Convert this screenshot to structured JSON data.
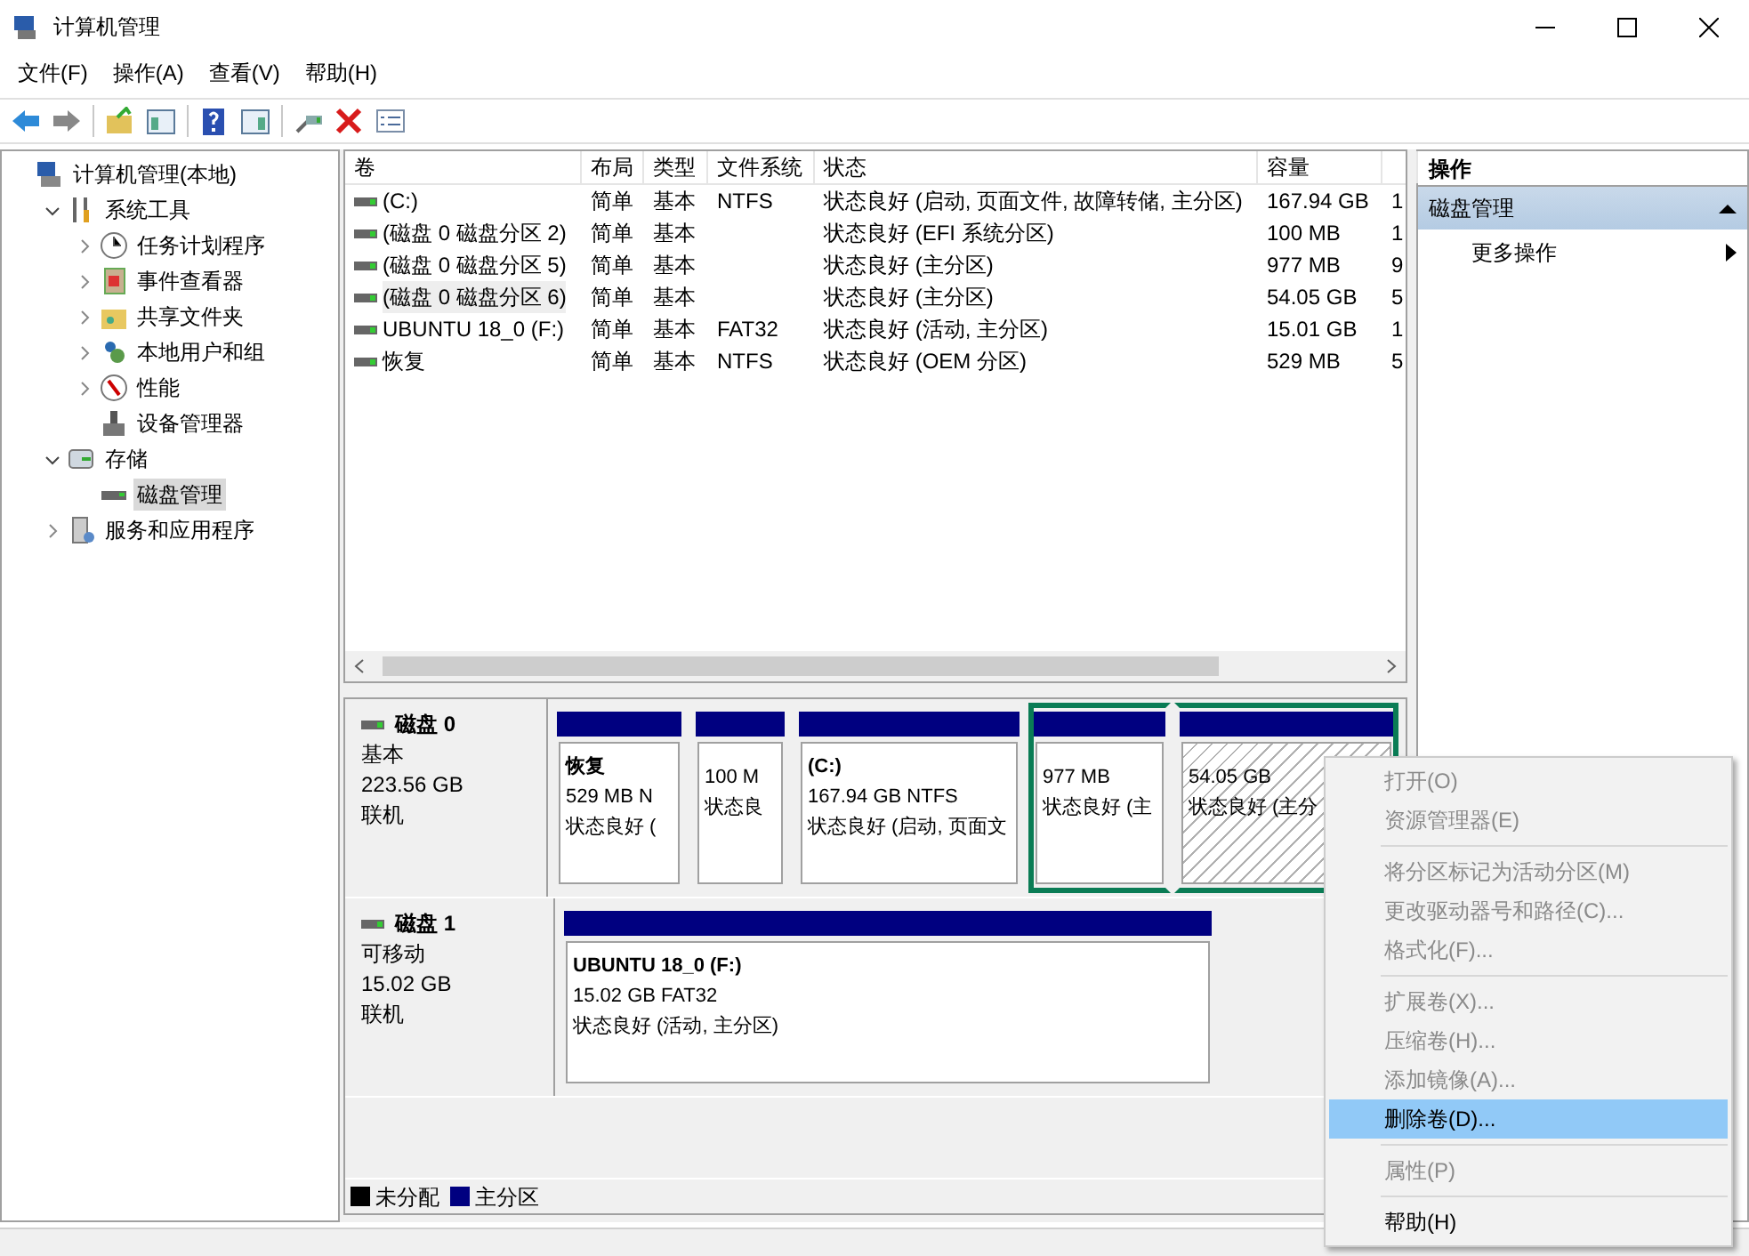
{
  "window": {
    "title": "计算机管理"
  },
  "menu": [
    "文件(F)",
    "操作(A)",
    "查看(V)",
    "帮助(H)"
  ],
  "tree": [
    {
      "label": "计算机管理(本地)",
      "selected": false,
      "children": [
        {
          "label": "系统工具",
          "selected": false,
          "expanded": true,
          "children": [
            {
              "label": "任务计划程序",
              "selected": false,
              "expanded": false
            },
            {
              "label": "事件查看器",
              "selected": false,
              "expanded": false
            },
            {
              "label": "共享文件夹",
              "selected": false,
              "expanded": false
            },
            {
              "label": "本地用户和组",
              "selected": false,
              "expanded": false
            },
            {
              "label": "性能",
              "selected": false,
              "expanded": false
            },
            {
              "label": "设备管理器",
              "selected": false
            }
          ]
        },
        {
          "label": "存储",
          "selected": false,
          "expanded": true,
          "children": [
            {
              "label": "磁盘管理",
              "selected": true
            }
          ]
        },
        {
          "label": "服务和应用程序",
          "selected": false,
          "expanded": false
        }
      ]
    }
  ],
  "table": {
    "columns": [
      "卷",
      "布局",
      "类型",
      "文件系统",
      "状态",
      "容量",
      ""
    ],
    "rows": [
      {
        "selected": false,
        "cells": [
          "(C:)",
          "简单",
          "基本",
          "NTFS",
          "状态良好 (启动, 页面文件, 故障转储, 主分区)",
          "167.94 GB",
          "1"
        ]
      },
      {
        "selected": false,
        "cells": [
          "(磁盘 0 磁盘分区 2)",
          "简单",
          "基本",
          "",
          "状态良好 (EFI 系统分区)",
          "100 MB",
          "1"
        ]
      },
      {
        "selected": false,
        "cells": [
          "(磁盘 0 磁盘分区 5)",
          "简单",
          "基本",
          "",
          "状态良好 (主分区)",
          "977 MB",
          "9"
        ]
      },
      {
        "selected": true,
        "cells": [
          "(磁盘 0 磁盘分区 6)",
          "简单",
          "基本",
          "",
          "状态良好 (主分区)",
          "54.05 GB",
          "5"
        ]
      },
      {
        "selected": false,
        "cells": [
          "UBUNTU 18_0 (F:)",
          "简单",
          "基本",
          "FAT32",
          "状态良好 (活动, 主分区)",
          "15.01 GB",
          "1"
        ]
      },
      {
        "selected": false,
        "cells": [
          "恢复",
          "简单",
          "基本",
          "NTFS",
          "状态良好 (OEM 分区)",
          "529 MB",
          "5"
        ]
      }
    ]
  },
  "disks": [
    {
      "name": "磁盘 0",
      "type": "基本",
      "size": "223.56 GB",
      "status": "联机",
      "partitions": [
        {
          "title": "恢复",
          "size": "529 MB N",
          "status": "状态良好 (",
          "selected": false,
          "highlighted": false
        },
        {
          "size": "100 M",
          "status": "状态良",
          "selected": false,
          "highlighted": false
        },
        {
          "title": "(C:)",
          "size": "167.94 GB NTFS",
          "status": "状态良好 (启动, 页面文",
          "selected": false,
          "highlighted": false
        },
        {
          "size": "977 MB",
          "status": "状态良好 (主",
          "selected": false,
          "highlighted": true
        },
        {
          "size": "54.05 GB",
          "status": "状态良好 (主分",
          "selected": true,
          "highlighted": true
        }
      ]
    },
    {
      "name": "磁盘 1",
      "type": "可移动",
      "size": "15.02 GB",
      "status": "联机",
      "partitions": [
        {
          "title": "UBUNTU 18_0  (F:)",
          "size": "15.02 GB FAT32",
          "status": "状态良好 (活动, 主分区)",
          "selected": false,
          "highlighted": false
        }
      ]
    }
  ],
  "legend": [
    {
      "label": "未分配",
      "color": "#000000"
    },
    {
      "label": "主分区",
      "color": "#000080"
    }
  ],
  "actions": {
    "header": "操作",
    "section": {
      "label": "磁盘管理",
      "expanded": true
    },
    "items": [
      "更多操作"
    ]
  },
  "context_menu": [
    {
      "kind": "item",
      "label": "打开(O)",
      "disabled": true,
      "selected": false
    },
    {
      "kind": "item",
      "label": "资源管理器(E)",
      "disabled": true,
      "selected": false
    },
    {
      "kind": "separator"
    },
    {
      "kind": "item",
      "label": "将分区标记为活动分区(M)",
      "disabled": true,
      "selected": false
    },
    {
      "kind": "item",
      "label": "更改驱动器号和路径(C)...",
      "disabled": true,
      "selected": false
    },
    {
      "kind": "item",
      "label": "格式化(F)...",
      "disabled": true,
      "selected": false
    },
    {
      "kind": "separator"
    },
    {
      "kind": "item",
      "label": "扩展卷(X)...",
      "disabled": true,
      "selected": false
    },
    {
      "kind": "item",
      "label": "压缩卷(H)...",
      "disabled": true,
      "selected": false
    },
    {
      "kind": "item",
      "label": "添加镜像(A)...",
      "disabled": true,
      "selected": false
    },
    {
      "kind": "item",
      "label": "删除卷(D)...",
      "disabled": false,
      "selected": true
    },
    {
      "kind": "separator"
    },
    {
      "kind": "item",
      "label": "属性(P)",
      "disabled": true,
      "selected": false
    },
    {
      "kind": "separator"
    },
    {
      "kind": "item",
      "label": "帮助(H)",
      "disabled": false,
      "selected": false
    }
  ]
}
